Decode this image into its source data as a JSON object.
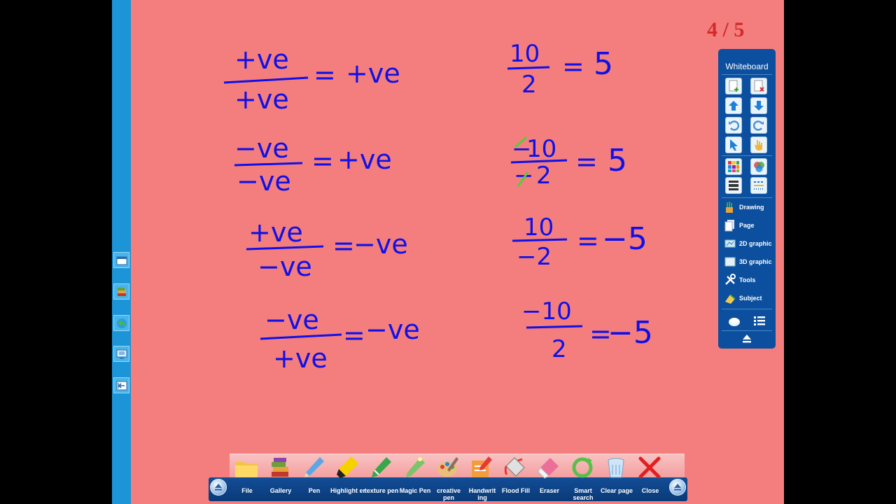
{
  "page": {
    "current": "4",
    "total": "5",
    "counter_text": "4 / 5"
  },
  "left_strip": {
    "buttons": [
      {
        "name": "window-button",
        "icon": "window-icon"
      },
      {
        "name": "books-button",
        "icon": "books-icon"
      },
      {
        "name": "globe-button",
        "icon": "globe-icon"
      },
      {
        "name": "screen-button",
        "icon": "screen-icon"
      },
      {
        "name": "exit-button",
        "icon": "exit-icon"
      }
    ]
  },
  "board": {
    "ink_color": "#1010e6",
    "correction_color": "#4fcf3a",
    "left_rules": [
      {
        "num": "+ve",
        "den": "+ve",
        "result": "+ve"
      },
      {
        "num": "−ve",
        "den": "−ve",
        "result": "+ve"
      },
      {
        "num": "+ve",
        "den": "−ve",
        "result": "−ve"
      },
      {
        "num": "−ve",
        "den": "+ve",
        "result": "−ve"
      }
    ],
    "right_examples": [
      {
        "num": "10",
        "den": "2",
        "result": "5"
      },
      {
        "num": "10",
        "den": "2",
        "result": "5",
        "num_sign": "−",
        "den_sign": "−"
      },
      {
        "num": "10",
        "den": "−2",
        "result": "−5"
      },
      {
        "num": "−10",
        "den": "2",
        "result": "−5"
      }
    ],
    "equals": "="
  },
  "panel": {
    "title": "Whiteboard",
    "menu": [
      {
        "label": "Drawing",
        "icon": "drawing-icon"
      },
      {
        "label": "Page",
        "icon": "page-icon"
      },
      {
        "label": "2D graphic",
        "icon": "2d-graphic-icon"
      },
      {
        "label": "3D graphic",
        "icon": "3d-graphic-icon"
      },
      {
        "label": "Tools",
        "icon": "tools-icon"
      },
      {
        "label": "Subject",
        "icon": "subject-icon"
      }
    ],
    "colors": {
      "background": "#0b4f9e",
      "accent": "#ffffff"
    }
  },
  "toolbar": {
    "items": [
      {
        "label": "File",
        "icon": "folder-icon"
      },
      {
        "label": "Gallery",
        "icon": "gallery-icon"
      },
      {
        "label": "Pen",
        "icon": "pen-icon"
      },
      {
        "label": "Highlight er",
        "icon": "highlighter-icon"
      },
      {
        "label": "texture pen",
        "icon": "texture-pen-icon"
      },
      {
        "label": "Magic Pen",
        "icon": "magic-pen-icon"
      },
      {
        "label": "creative pen",
        "icon": "creative-pen-icon"
      },
      {
        "label": "Handwrit ing",
        "icon": "handwriting-icon"
      },
      {
        "label": "Flood Fill",
        "icon": "flood-fill-icon"
      },
      {
        "label": "Eraser",
        "icon": "eraser-icon"
      },
      {
        "label": "Smart search",
        "icon": "smart-search-icon"
      },
      {
        "label": "Clear page",
        "icon": "recycle-bin-icon"
      },
      {
        "label": "Close",
        "icon": "close-icon"
      }
    ],
    "colors": {
      "base": "#124d96",
      "top": "#f9c2c2"
    }
  },
  "colors": {
    "stage": "#f47e7e",
    "strip": "#1b94d8",
    "counter": "#d42a2a"
  }
}
